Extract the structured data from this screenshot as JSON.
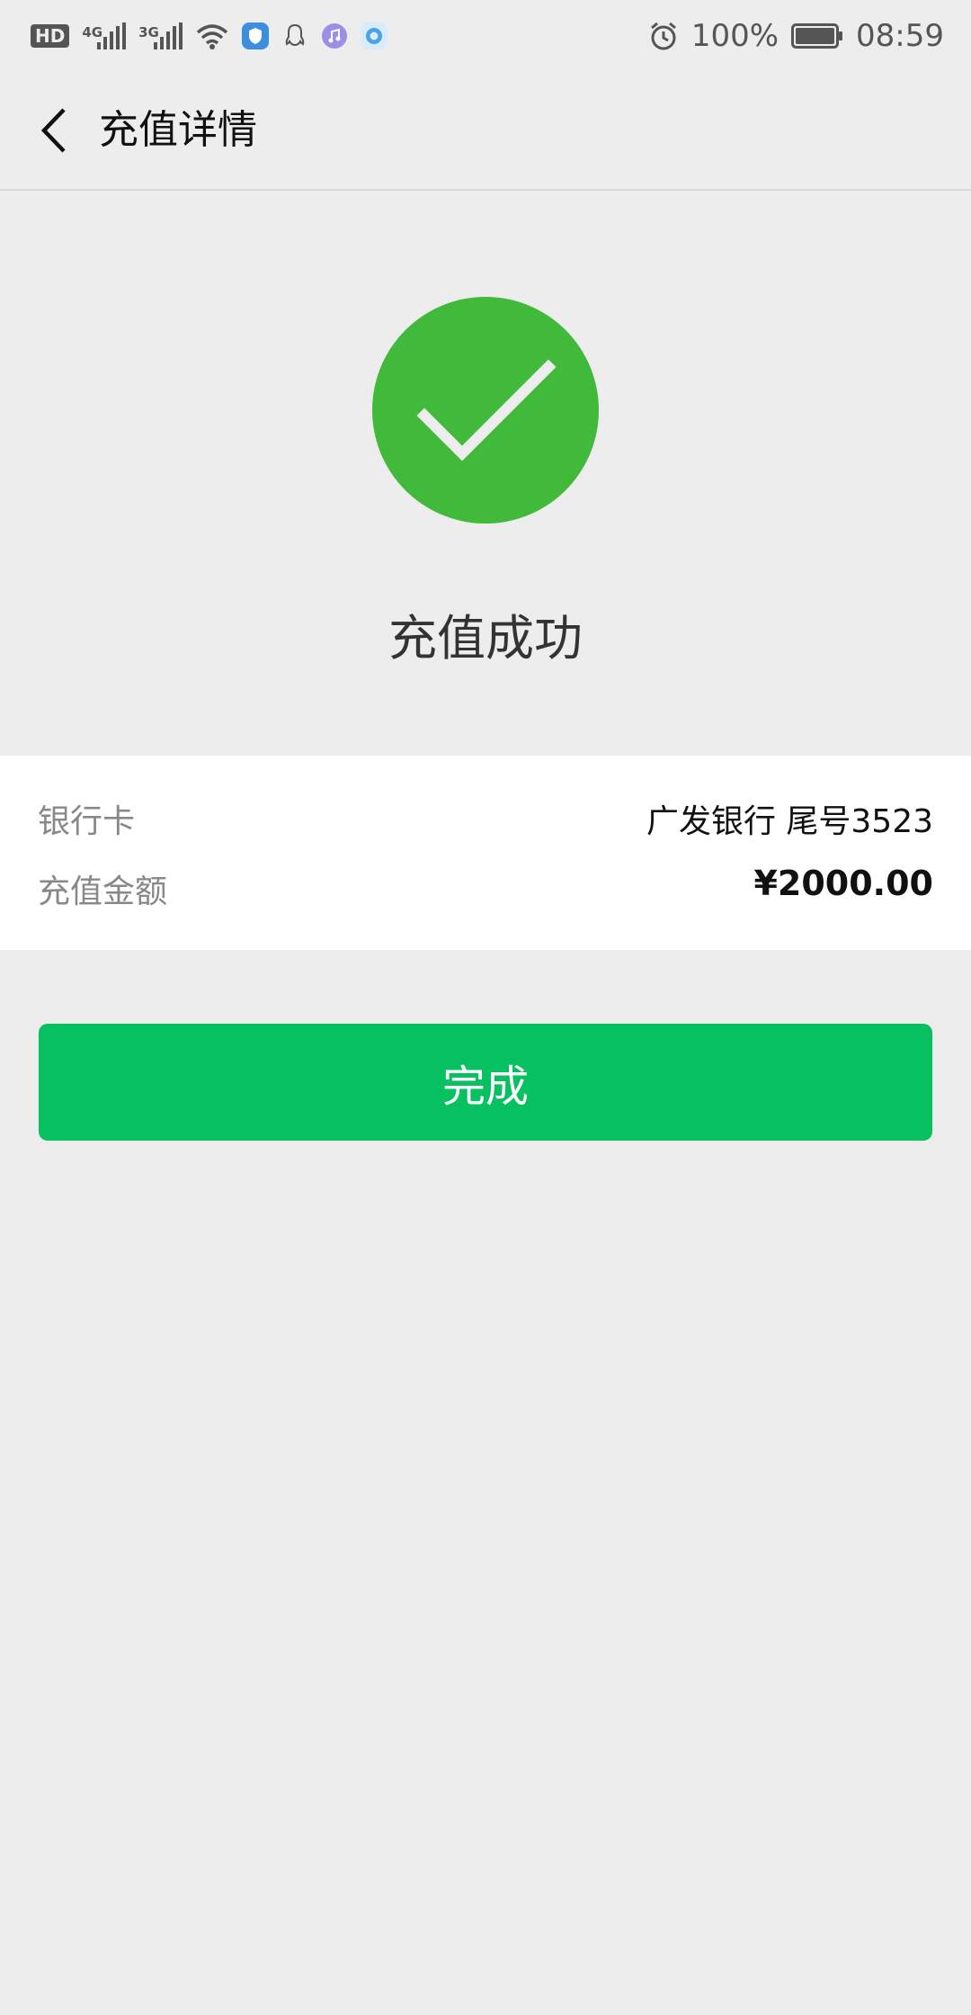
{
  "status_bar": {
    "hd": "HD",
    "net1": "4G",
    "net2": "3G",
    "battery": "100%",
    "time": "08:59"
  },
  "header": {
    "title": "充值详情"
  },
  "result": {
    "status_text": "充值成功",
    "icon": "check-circle-icon",
    "icon_color": "#41b93a"
  },
  "details": {
    "card_label": "银行卡",
    "card_value": "广发银行 尾号3523",
    "amount_label": "充值金额",
    "amount_value": "¥2000.00"
  },
  "actions": {
    "done_label": "完成",
    "done_color": "#07c160"
  }
}
